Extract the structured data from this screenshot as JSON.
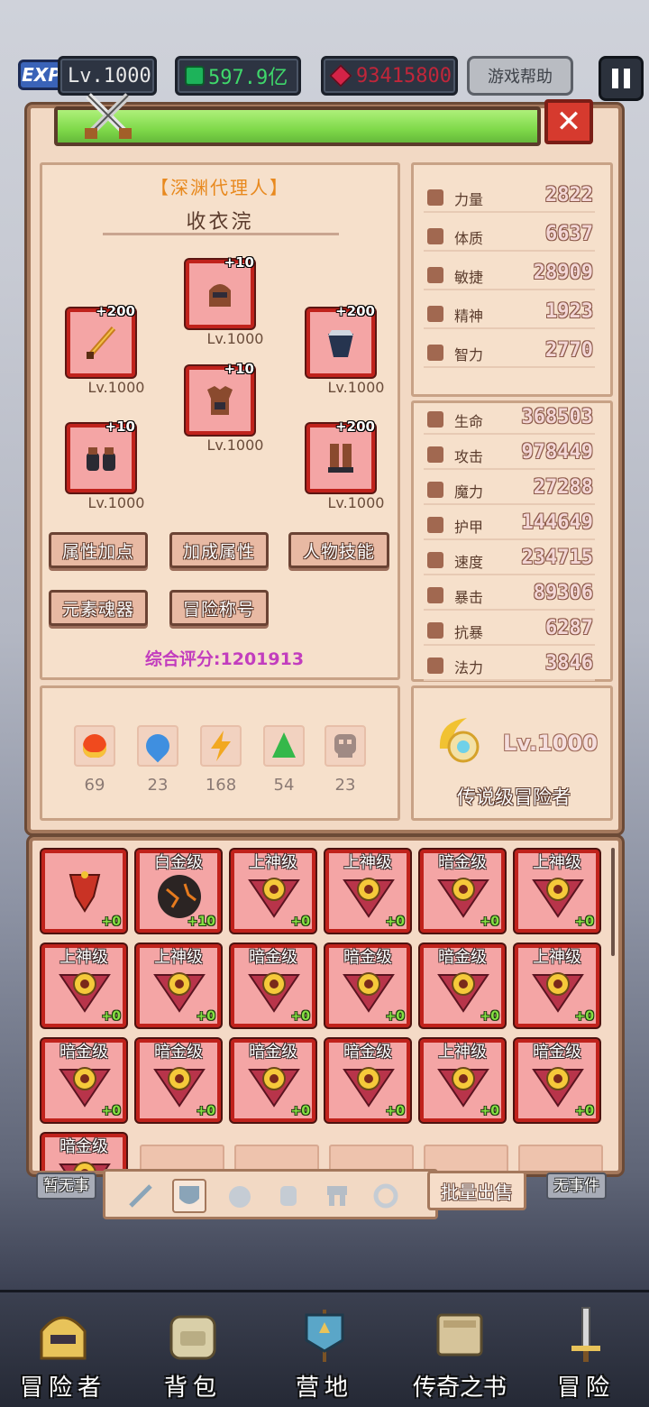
{
  "header": {
    "exp_badge": "EXP",
    "level": "Lv.1000",
    "currency_green": "597.9亿",
    "currency_red": "93415800",
    "help_label": "游戏帮助"
  },
  "character": {
    "title": "【深渊代理人】",
    "name": "收衣浣",
    "equipment": [
      {
        "slot": "weapon",
        "plus": "+200",
        "level": "Lv.1000"
      },
      {
        "slot": "helmet",
        "plus": "+10",
        "level": "Lv.1000"
      },
      {
        "slot": "accessory",
        "plus": "+200",
        "level": "Lv.1000"
      },
      {
        "slot": "armor",
        "plus": "+10",
        "level": "Lv.1000"
      },
      {
        "slot": "gloves",
        "plus": "+10",
        "level": "Lv.1000"
      },
      {
        "slot": "boots",
        "plus": "+200",
        "level": "Lv.1000"
      }
    ],
    "buttons": [
      "属性加点",
      "加成属性",
      "人物技能",
      "元素魂器",
      "冒险称号"
    ],
    "score": "综合评分:1201913"
  },
  "base_stats": [
    {
      "label": "力量",
      "value": "2822"
    },
    {
      "label": "体质",
      "value": "6637"
    },
    {
      "label": "敏捷",
      "value": "28909"
    },
    {
      "label": "精神",
      "value": "1923"
    },
    {
      "label": "智力",
      "value": "2770"
    }
  ],
  "combat_stats": [
    {
      "label": "生命",
      "value": "368503"
    },
    {
      "label": "攻击",
      "value": "978449"
    },
    {
      "label": "魔力",
      "value": "27288"
    },
    {
      "label": "护甲",
      "value": "144649"
    },
    {
      "label": "速度",
      "value": "234715"
    },
    {
      "label": "暴击",
      "value": "89306"
    },
    {
      "label": "抗暴",
      "value": "6287"
    },
    {
      "label": "法力",
      "value": "3846"
    }
  ],
  "elements": [
    {
      "name": "fire",
      "value": "69",
      "color": "#f04a1e"
    },
    {
      "name": "water",
      "value": "23",
      "color": "#3f8fe0"
    },
    {
      "name": "lightning",
      "value": "168",
      "color": "#f2a820"
    },
    {
      "name": "nature",
      "value": "54",
      "color": "#35b84a"
    },
    {
      "name": "dark",
      "value": "23",
      "color": "#a08a84"
    }
  ],
  "rank": {
    "level": "Lv.1000",
    "title": "传说级冒险者"
  },
  "inventory": [
    {
      "grade": "",
      "enh": "+0",
      "kind": "shield"
    },
    {
      "grade": "白金级",
      "enh": "+10",
      "kind": "orb"
    },
    {
      "grade": "上神级",
      "enh": "+0",
      "kind": "emblem"
    },
    {
      "grade": "上神级",
      "enh": "+0",
      "kind": "emblem"
    },
    {
      "grade": "暗金级",
      "enh": "+0",
      "kind": "emblem"
    },
    {
      "grade": "上神级",
      "enh": "+0",
      "kind": "emblem"
    },
    {
      "grade": "上神级",
      "enh": "+0",
      "kind": "emblem"
    },
    {
      "grade": "上神级",
      "enh": "+0",
      "kind": "emblem"
    },
    {
      "grade": "暗金级",
      "enh": "+0",
      "kind": "emblem"
    },
    {
      "grade": "暗金级",
      "enh": "+0",
      "kind": "emblem"
    },
    {
      "grade": "暗金级",
      "enh": "+0",
      "kind": "emblem"
    },
    {
      "grade": "上神级",
      "enh": "+0",
      "kind": "emblem"
    },
    {
      "grade": "暗金级",
      "enh": "+0",
      "kind": "emblem"
    },
    {
      "grade": "暗金级",
      "enh": "+0",
      "kind": "emblem"
    },
    {
      "grade": "暗金级",
      "enh": "+0",
      "kind": "emblem"
    },
    {
      "grade": "暗金级",
      "enh": "+0",
      "kind": "emblem"
    },
    {
      "grade": "上神级",
      "enh": "+0",
      "kind": "emblem"
    },
    {
      "grade": "暗金级",
      "enh": "+0",
      "kind": "emblem"
    },
    {
      "grade": "暗金级",
      "enh": "",
      "kind": "emblem"
    }
  ],
  "inventory_tabs": [
    "weapon-tab",
    "armor-tab",
    "helmet-tab",
    "gloves-tab",
    "boots-tab",
    "ring-tab"
  ],
  "bulk_sell": "批量出售",
  "events": {
    "left": "暂无事",
    "right": "无事件"
  },
  "nav": [
    "冒险者",
    "背包",
    "营地",
    "传奇之书",
    "冒险"
  ]
}
